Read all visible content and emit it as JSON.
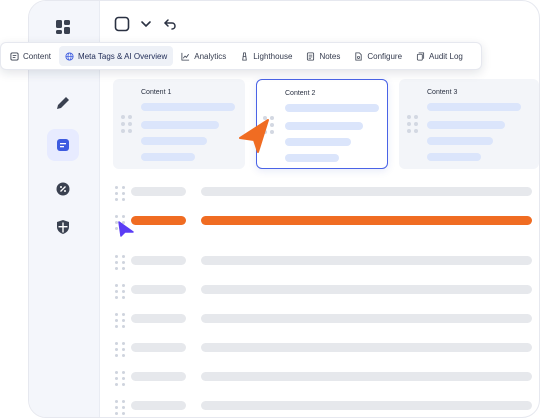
{
  "sidebar": {
    "items": [
      {
        "icon": "dashboard-grid-icon",
        "active": false
      },
      {
        "icon": "pencil-icon",
        "active": false
      },
      {
        "icon": "document-icon",
        "active": true
      },
      {
        "icon": "percent-badge-icon",
        "active": false
      },
      {
        "icon": "shield-icon",
        "active": false
      }
    ]
  },
  "topbar": {
    "icons": [
      "checkbox-icon",
      "chevron-down-icon",
      "undo-icon"
    ]
  },
  "tabs": [
    {
      "label": "Content",
      "icon": "file-icon",
      "active": false
    },
    {
      "label": "Meta Tags & AI Overview",
      "icon": "globe-icon",
      "active": true
    },
    {
      "label": "Analytics",
      "icon": "chart-line-icon",
      "active": false
    },
    {
      "label": "Lighthouse",
      "icon": "lighthouse-icon",
      "active": false
    },
    {
      "label": "Notes",
      "icon": "notes-icon",
      "active": false
    },
    {
      "label": "Configure",
      "icon": "config-file-icon",
      "active": false
    },
    {
      "label": "Audit Log",
      "icon": "audit-log-icon",
      "active": false
    }
  ],
  "cards": [
    {
      "title": "Content 1",
      "selected": false
    },
    {
      "title": "Content 2",
      "selected": true
    },
    {
      "title": "Content 3",
      "selected": false
    }
  ],
  "colors": {
    "accent_orange": "#f06c22",
    "accent_blue": "#4a63e6",
    "cursor_purple": "#5b3df5"
  }
}
